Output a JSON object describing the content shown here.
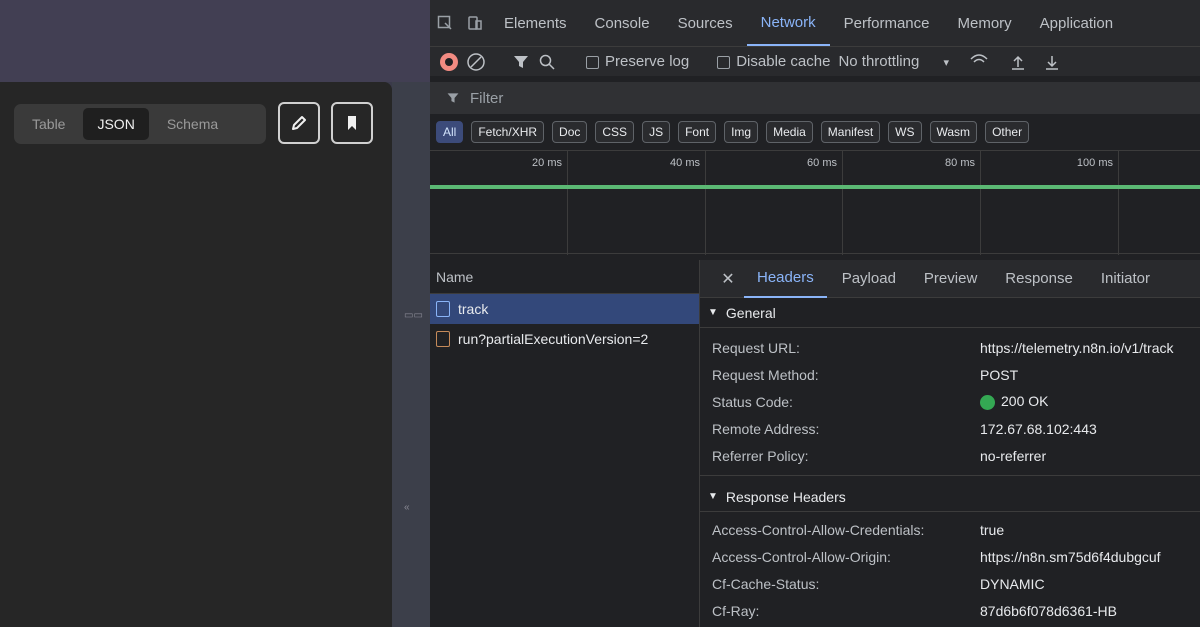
{
  "view_toggle": {
    "options": [
      "Table",
      "JSON",
      "Schema"
    ],
    "selected": "JSON"
  },
  "tools": {
    "edit_icon": "pencil-icon",
    "bookmark_icon": "bookmark-icon"
  },
  "devtools": {
    "tabs": [
      "Elements",
      "Console",
      "Sources",
      "Network",
      "Performance",
      "Memory",
      "Application"
    ],
    "active_tab": "Network",
    "toolbar": {
      "preserve_log": "Preserve log",
      "disable_cache": "Disable cache",
      "throttling": "No throttling"
    },
    "filter_placeholder": "Filter",
    "type_filters": [
      "All",
      "Fetch/XHR",
      "Doc",
      "CSS",
      "JS",
      "Font",
      "Img",
      "Media",
      "Manifest",
      "WS",
      "Wasm",
      "Other"
    ],
    "active_type": "All",
    "timeline_ticks": [
      "20 ms",
      "40 ms",
      "60 ms",
      "80 ms",
      "100 ms"
    ],
    "name_header": "Name",
    "requests": [
      {
        "name": "track",
        "selected": true
      },
      {
        "name": "run?partialExecutionVersion=2",
        "selected": false
      }
    ],
    "detail_tabs": [
      "Headers",
      "Payload",
      "Preview",
      "Response",
      "Initiator"
    ],
    "active_detail_tab": "Headers",
    "general": {
      "title": "General",
      "rows": [
        {
          "key": "Request URL:",
          "value": "https://telemetry.n8n.io/v1/track"
        },
        {
          "key": "Request Method:",
          "value": "POST"
        },
        {
          "key": "Status Code:",
          "value": "200 OK"
        },
        {
          "key": "Remote Address:",
          "value": "172.67.68.102:443"
        },
        {
          "key": "Referrer Policy:",
          "value": "no-referrer"
        }
      ]
    },
    "response_headers": {
      "title": "Response Headers",
      "rows": [
        {
          "key": "Access-Control-Allow-Credentials:",
          "value": "true"
        },
        {
          "key": "Access-Control-Allow-Origin:",
          "value": "https://n8n.sm75d6f4dubgcuf"
        },
        {
          "key": "Cf-Cache-Status:",
          "value": "DYNAMIC"
        },
        {
          "key": "Cf-Ray:",
          "value": "87d6b6f078d6361-HB"
        }
      ]
    },
    "colors": {
      "status_ok": "#34a853",
      "active_accent": "#8ab4f8",
      "selected_row": "#33487a"
    }
  }
}
